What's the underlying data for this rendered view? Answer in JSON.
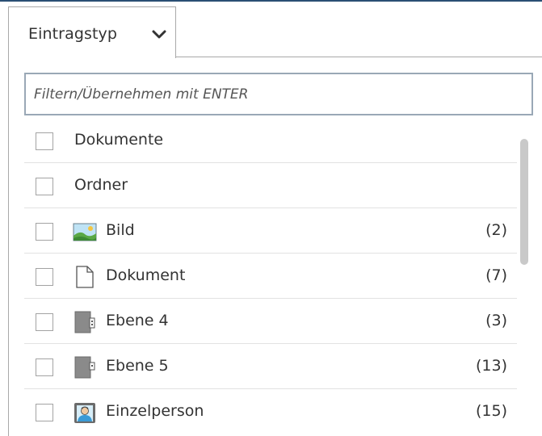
{
  "tab": {
    "label": "Eintragstyp"
  },
  "filter": {
    "placeholder": "Filtern/Übernehmen mit ENTER",
    "value": ""
  },
  "list": {
    "items": [
      {
        "label": "Dokumente",
        "count": "",
        "checked": false
      },
      {
        "label": "Ordner",
        "count": "",
        "checked": false
      },
      {
        "label": "Bild",
        "count": "(2)",
        "icon": "image-icon",
        "checked": false
      },
      {
        "label": "Dokument",
        "count": "(7)",
        "icon": "document-icon",
        "checked": false
      },
      {
        "label": "Ebene 4",
        "count": "(3)",
        "icon": "folder-level-4-icon",
        "checked": false
      },
      {
        "label": "Ebene 5",
        "count": "(13)",
        "icon": "folder-level-5-icon",
        "checked": false
      },
      {
        "label": "Einzelperson",
        "count": "(15)",
        "icon": "person-icon",
        "checked": false
      }
    ]
  },
  "colors": {
    "accent_top": "#2a4f74",
    "border": "#a9a9a9",
    "input_border": "#9aa8b6"
  }
}
